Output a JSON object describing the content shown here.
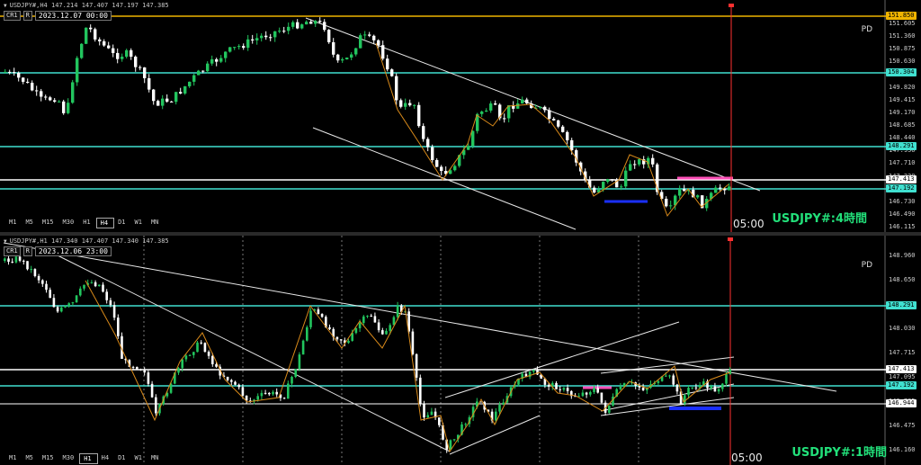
{
  "pane1": {
    "header": "USDJPY#,H4  147.214 147.407 147.197 147.385",
    "cr_label": "CR1",
    "r_label": "R",
    "date_stamp": "2023.12.07 00:00",
    "pd_label": "PD",
    "pair_label": "USDJPY#:4時間",
    "time_label": "05:00",
    "timeframes": [
      "M1",
      "M5",
      "M15",
      "M30",
      "H1",
      "H4",
      "D1",
      "W1",
      "MN"
    ],
    "active_timeframe": "H4",
    "axis_prices": [
      "151.605",
      "151.360",
      "150.875",
      "150.630",
      "150.145",
      "149.820",
      "149.415",
      "149.170",
      "148.685",
      "148.440",
      "147.950",
      "147.710",
      "147.220",
      "146.980",
      "146.730",
      "146.490",
      "146.115"
    ],
    "price_tags": [
      {
        "value": "151.850",
        "color": "#f0b400",
        "text_color": "#000"
      },
      {
        "value": "150.304",
        "color": "#40e0d0",
        "text_color": "#000"
      },
      {
        "value": "148.291",
        "color": "#40e0d0",
        "text_color": "#000"
      },
      {
        "value": "147.413",
        "color": "#ffffff",
        "text_color": "#000"
      },
      {
        "value": "147.192",
        "color": "#40e0d0",
        "text_color": "#000"
      }
    ]
  },
  "pane2": {
    "header": "USDJPY#,H1  147.340 147.407 147.340 147.385",
    "cr_label": "CR1",
    "r_label": "R",
    "date_stamp": "2023.12.06 23:00",
    "pd_label": "PD",
    "pair_label": "USDJPY#:1時間",
    "time_label": "05:00",
    "timeframes": [
      "M1",
      "M5",
      "M15",
      "M30",
      "H1",
      "H4",
      "D1",
      "W1",
      "MN"
    ],
    "active_timeframe": "H1",
    "axis_prices": [
      "148.960",
      "148.650",
      "148.340",
      "148.030",
      "147.715",
      "147.095",
      "146.785",
      "146.475",
      "146.160"
    ],
    "price_tags": [
      {
        "value": "148.291",
        "color": "#40e0d0",
        "text_color": "#000"
      },
      {
        "value": "147.413",
        "color": "#ffffff",
        "text_color": "#000"
      },
      {
        "value": "147.192",
        "color": "#40e0d0",
        "text_color": "#000"
      },
      {
        "value": "146.944",
        "color": "#ffffff",
        "text_color": "#000"
      }
    ]
  },
  "colors": {
    "background": "#000000",
    "bull": "#22c55e",
    "bear": "#ffffff",
    "support": "#40e0d0",
    "resistance_gold": "#f0b400",
    "zigzag": "#d98a1a",
    "pink_zone": "#ff4fb8",
    "blue_zone": "#1a2fff",
    "now_line": "#ff3030",
    "label_green": "#22e07a"
  }
}
